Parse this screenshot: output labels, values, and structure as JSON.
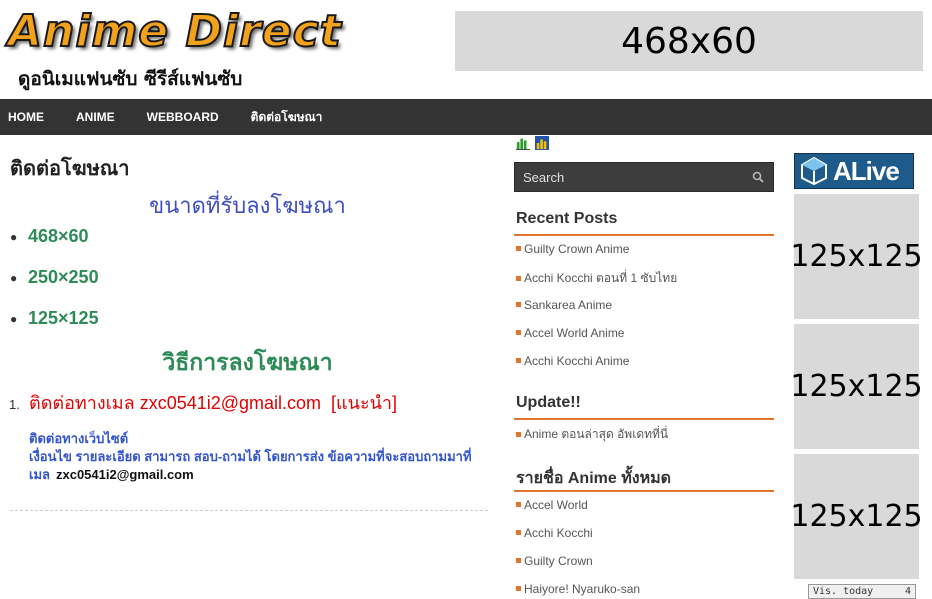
{
  "header": {
    "logo_text": "Anime Direct",
    "tagline": "ดูอนิเมแฟนซับ ซีรีส์แฟนซับ",
    "banner_label": "468x60"
  },
  "nav": {
    "items": [
      {
        "label": "HOME"
      },
      {
        "label": "ANIME"
      },
      {
        "label": "WEBBOARD"
      },
      {
        "label": "ติดต่อโฆษณา"
      }
    ]
  },
  "main": {
    "page_title": "ติดต่อโฆษณา",
    "sizes_heading": "ขนาดที่รับลงโฆษณา",
    "sizes": [
      "468×60",
      "250×250",
      "125×125"
    ],
    "method_heading": "วิธีการลงโฆษณา",
    "method_number": "1.",
    "method_text": "ติดต่อทางเมล zxc0541i2@gmail.com",
    "method_recommend": "[แนะนำ]",
    "web_label": "ติดต่อทางเว็บไซต์",
    "web_detail": "เงื่อนไข รายละเอียด สามารถ สอบ-ถามได้ โดยการส่ง ข้อความที่จะสอบถามมาที่เมล",
    "web_email": "zxc0541i2@gmail.com"
  },
  "sidebar": {
    "search_placeholder": "Search",
    "recent_title": "Recent Posts",
    "recent": [
      "Guilty Crown Anime",
      "Acchi Kocchi ตอนที่ 1 ซับไทย",
      "Sankarea Anime",
      "Accel World Anime",
      "Acchi Kocchi Anime"
    ],
    "update_title": "Update!!",
    "update": [
      "Anime ตอนล่าสุด อัพเดทที่นี่"
    ],
    "list_title": "รายชื่อ Anime ทั้งหมด",
    "list": [
      "Accel World",
      "Acchi Kocchi",
      "Guilty Crown",
      "Haiyore! Nyaruko-san"
    ]
  },
  "ads": {
    "logo_text": "ALive",
    "slot_label": "125x125",
    "vis_label": "Vis. today",
    "vis_value": "4"
  },
  "colors": {
    "nav_bg": "#333333",
    "accent": "#e0762a",
    "heading_blue": "#3f4fbf",
    "heading_green": "#2e8b57",
    "red": "#e00000"
  }
}
